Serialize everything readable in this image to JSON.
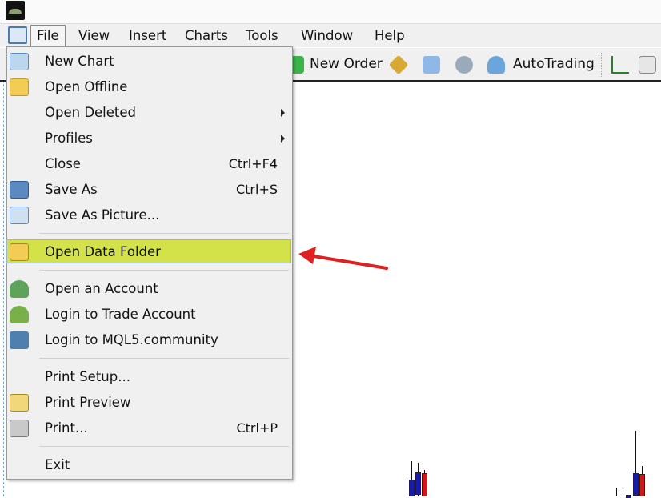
{
  "menubar": {
    "items": [
      "File",
      "View",
      "Insert",
      "Charts",
      "Tools",
      "Window",
      "Help"
    ]
  },
  "toolbar": {
    "new_order": "New Order",
    "autotrading": "AutoTrading"
  },
  "file_menu": {
    "items": [
      {
        "label": "New Chart",
        "icon": "new-chart-icon"
      },
      {
        "label": "Open Offline",
        "icon": "folder-open-icon"
      },
      {
        "label": "Open Deleted",
        "submenu": true
      },
      {
        "label": "Profiles",
        "submenu": true
      },
      {
        "label": "Close",
        "shortcut": "Ctrl+F4"
      },
      {
        "label": "Save As",
        "shortcut": "Ctrl+S",
        "icon": "save-icon"
      },
      {
        "label": "Save As Picture...",
        "icon": "save-picture-icon"
      },
      {
        "label": "Open Data Folder",
        "icon": "folder-icon",
        "highlighted": true
      },
      {
        "label": "Open an Account",
        "icon": "user-add-icon"
      },
      {
        "label": "Login to Trade Account",
        "icon": "user-login-icon"
      },
      {
        "label": "Login to MQL5.community",
        "icon": "mql5-login-icon"
      },
      {
        "label": "Print Setup..."
      },
      {
        "label": "Print Preview",
        "icon": "print-preview-icon"
      },
      {
        "label": "Print...",
        "shortcut": "Ctrl+P",
        "icon": "printer-icon"
      },
      {
        "label": "Exit"
      }
    ]
  },
  "colors": {
    "highlight": "#d4e24a",
    "annotation_arrow": "#e02020",
    "bull_candle": "#1a1ab0",
    "bear_candle": "#cc1a1a"
  }
}
